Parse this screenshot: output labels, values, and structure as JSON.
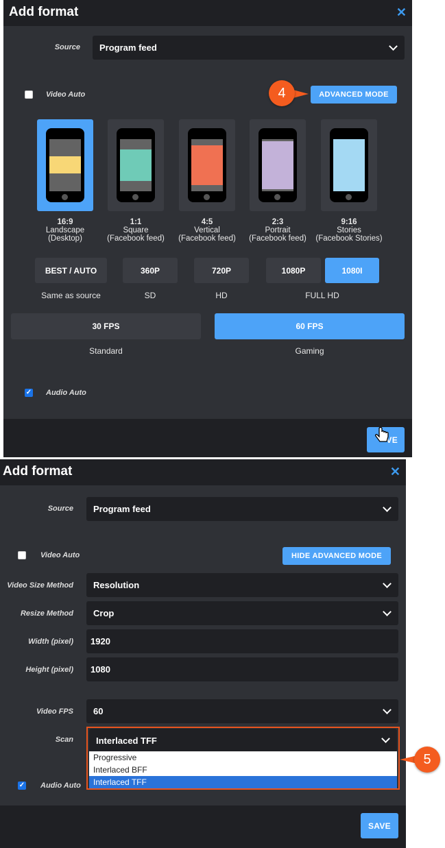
{
  "panel1": {
    "title": "Add format",
    "close_icon": "close-icon",
    "source_label": "Source",
    "source_value": "Program feed",
    "video_auto_label": "Video Auto",
    "video_auto_checked": false,
    "advanced_btn": "ADVANCED MODE",
    "callout": "4",
    "formats": [
      {
        "ratio": "16:9",
        "name": "Landscape",
        "sub": "(Desktop)",
        "selected": true,
        "color": "#f8d776"
      },
      {
        "ratio": "1:1",
        "name": "Square",
        "sub": "(Facebook feed)",
        "selected": false,
        "color": "#6fcbb7"
      },
      {
        "ratio": "4:5",
        "name": "Vertical",
        "sub": "(Facebook feed)",
        "selected": false,
        "color": "#f07152"
      },
      {
        "ratio": "2:3",
        "name": "Portrait",
        "sub": "(Facebook feed)",
        "selected": false,
        "color": "#c3b2d9"
      },
      {
        "ratio": "9:16",
        "name": "Stories",
        "sub": "(Facebook Stories)",
        "selected": false,
        "color": "#a4d9f3"
      }
    ],
    "resolutions": [
      {
        "label": "BEST / AUTO",
        "selected": false
      },
      {
        "label": "360P",
        "selected": false
      },
      {
        "label": "720P",
        "selected": false
      },
      {
        "label": "1080P",
        "selected": false
      },
      {
        "label": "1080I",
        "selected": true
      }
    ],
    "res_captions": [
      "Same as source",
      "SD",
      "HD",
      "FULL HD"
    ],
    "fps": [
      {
        "label": "30 FPS",
        "caption": "Standard",
        "selected": false
      },
      {
        "label": "60 FPS",
        "caption": "Gaming",
        "selected": true
      }
    ],
    "audio_auto_label": "Audio Auto",
    "audio_auto_checked": true,
    "save_btn_partial": "VE"
  },
  "panel2": {
    "title": "Add format",
    "source_label": "Source",
    "source_value": "Program feed",
    "video_auto_label": "Video Auto",
    "hide_advanced_btn": "HIDE ADVANCED MODE",
    "fields": [
      {
        "label": "Video Size Method",
        "value": "Resolution",
        "type": "select"
      },
      {
        "label": "Resize Method",
        "value": "Crop",
        "type": "select"
      },
      {
        "label": "Width (pixel)",
        "value": "1920",
        "type": "input"
      },
      {
        "label": "Height (pixel)",
        "value": "1080",
        "type": "input"
      }
    ],
    "fps_label": "Video FPS",
    "fps_value": "60",
    "scan_label": "Scan",
    "scan_value": "Interlaced TFF",
    "scan_options": [
      "Progressive",
      "Interlaced BFF",
      "Interlaced TFF"
    ],
    "scan_selected": "Interlaced TFF",
    "audio_auto_label": "Audio Auto",
    "callout": "5",
    "save_btn": "SAVE"
  },
  "colors": {
    "accent": "#4da3f8",
    "panel": "#2f3136",
    "header": "#1f2024",
    "callout": "#f45c1f",
    "highlight": "#e8541e"
  }
}
